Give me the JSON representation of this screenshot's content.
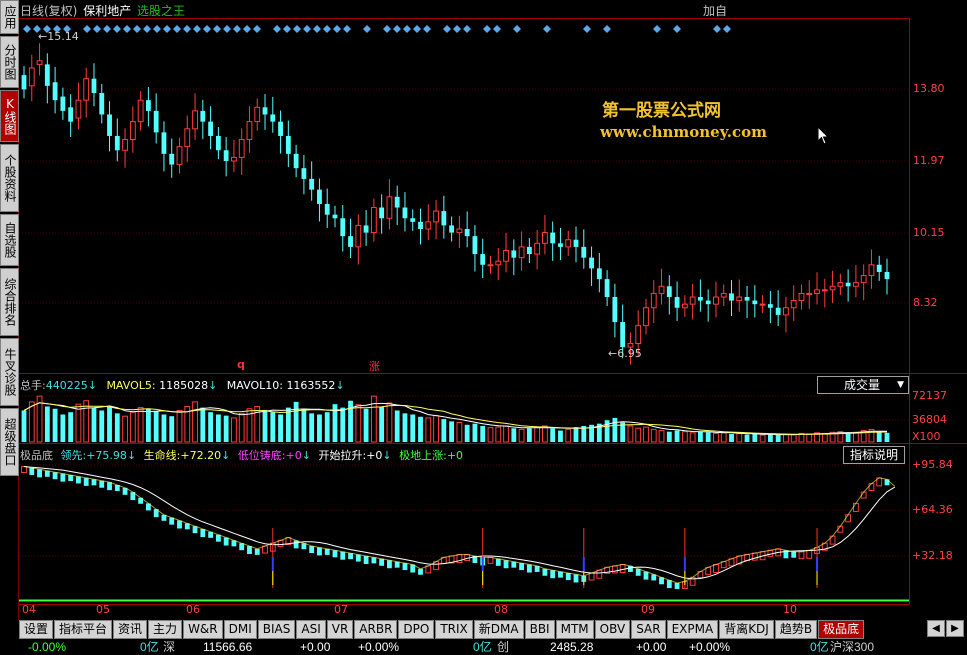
{
  "sidebar": [
    {
      "label": "应用",
      "active": false
    },
    {
      "label": "分时图",
      "active": false
    },
    {
      "label": "K线图",
      "active": true
    },
    {
      "label": "个股资料",
      "active": false
    },
    {
      "label": "自选股",
      "active": false
    },
    {
      "label": "综合排名",
      "active": false
    },
    {
      "label": "牛叉诊股",
      "active": false
    },
    {
      "label": "超级盘口",
      "active": false
    }
  ],
  "header": {
    "period": "日线(复权)",
    "stock_name": "保利地产",
    "formula": "选股之王",
    "right_label": "加自"
  },
  "watermark": {
    "line1": "第一股票公式网",
    "line2": "www.chnmoney.com"
  },
  "price_panel": {
    "high_label": "15.14",
    "low_label": "6.95",
    "axis_labels": [
      "13.80",
      "11.97",
      "10.15",
      "8.32"
    ],
    "marks": [
      {
        "text": "q"
      },
      {
        "text": "涨"
      }
    ]
  },
  "volume_panel": {
    "zongshou_label": "总手:",
    "zongshou_value": "440225",
    "mavol5_label": "MAVOL5:",
    "mavol5_value": "1185028",
    "mavol10_label": "MAVOL10:",
    "mavol10_value": "1163552",
    "selector": "成交量",
    "axis_labels": [
      "72137",
      "36804",
      "X100"
    ]
  },
  "indicator_panel": {
    "name": "极品底",
    "items": [
      {
        "label": "领先:",
        "value": "+75.98",
        "color": "#40e0e0"
      },
      {
        "label": "生命线:",
        "value": "+72.20",
        "color": "#ffff60"
      },
      {
        "label": "低位铸底:",
        "value": "+0",
        "color": "#ff40ff"
      },
      {
        "label": "开始拉升:",
        "value": "+0",
        "color": "#ffffff"
      },
      {
        "label": "极地上涨:",
        "value": "+0",
        "color": "#40ff40"
      }
    ],
    "explain_button": "指标说明",
    "axis_labels": [
      "+95.84",
      "+64.36",
      "+32.18"
    ]
  },
  "x_axis_labels": [
    "04",
    "05",
    "06",
    "07",
    "08",
    "09",
    "10"
  ],
  "tabs": [
    "设置",
    "指标平台",
    "资讯",
    "主力",
    "W&R",
    "DMI",
    "BIAS",
    "ASI",
    "VR",
    "ARBR",
    "DPO",
    "TRIX",
    "新DMA",
    "BBI",
    "MTM",
    "OBV",
    "SAR",
    "EXPMA",
    "背离KDJ",
    "趋势B",
    "极品底"
  ],
  "active_tab": "极品底",
  "status": {
    "idx1_change": "-0.00%",
    "idx1_amount": "0亿",
    "idx2_name": "深",
    "idx2_value": "11566.66",
    "idx2_change": "+0.00",
    "idx2_pct": "+0.00%",
    "idx2_amount": "0亿",
    "idx3_name": "创",
    "idx3_value": "2485.28",
    "idx3_change": "+0.00",
    "idx3_pct": "+0.00%",
    "idx3_amount": "0亿",
    "idx4_name": "沪深300"
  },
  "chart_data": {
    "type": "candlestick",
    "price_range": [
      6.5,
      16.0
    ],
    "indicator_range": [
      0,
      100
    ],
    "close": [
      14.2,
      14.8,
      15.0,
      14.3,
      13.9,
      13.6,
      13.3,
      13.9,
      14.5,
      14.1,
      13.5,
      12.9,
      12.5,
      12.8,
      13.3,
      13.9,
      13.6,
      13.0,
      12.4,
      12.1,
      12.6,
      13.1,
      13.6,
      13.3,
      12.9,
      12.5,
      12.2,
      12.3,
      12.8,
      13.3,
      13.7,
      13.5,
      13.3,
      12.9,
      12.4,
      12.0,
      11.7,
      11.4,
      11.0,
      10.7,
      10.6,
      10.1,
      9.8,
      10.4,
      10.2,
      10.9,
      10.6,
      11.2,
      10.9,
      10.6,
      10.5,
      10.3,
      10.5,
      10.8,
      10.4,
      10.2,
      10.3,
      10.1,
      9.6,
      9.3,
      9.3,
      9.4,
      9.7,
      9.5,
      9.8,
      9.6,
      9.9,
      10.2,
      9.9,
      9.8,
      10.0,
      9.8,
      9.5,
      9.2,
      8.9,
      8.4,
      7.7,
      7.0,
      7.1,
      7.6,
      8.1,
      8.5,
      8.7,
      8.4,
      8.1,
      8.2,
      8.4,
      8.3,
      8.2,
      8.4,
      8.5,
      8.3,
      8.4,
      8.3,
      8.2,
      8.2,
      8.1,
      7.9,
      8.1,
      8.3,
      8.5,
      8.5,
      8.6,
      8.6,
      8.7,
      8.8,
      8.7,
      8.8,
      9.0,
      9.3,
      9.1,
      8.9
    ],
    "open": [
      14.6,
      14.3,
      14.9,
      14.9,
      14.4,
      14.0,
      13.7,
      13.4,
      13.9,
      14.5,
      14.1,
      13.5,
      12.9,
      12.5,
      12.8,
      13.3,
      13.9,
      13.6,
      13.0,
      12.4,
      12.1,
      12.6,
      13.1,
      13.6,
      13.3,
      12.9,
      12.5,
      12.2,
      12.3,
      12.8,
      13.3,
      13.7,
      13.5,
      13.3,
      12.9,
      12.4,
      12.0,
      11.7,
      11.4,
      11.0,
      10.7,
      10.6,
      10.1,
      9.8,
      10.4,
      10.2,
      10.9,
      10.6,
      11.2,
      10.9,
      10.6,
      10.5,
      10.3,
      10.5,
      10.8,
      10.4,
      10.2,
      10.3,
      10.1,
      9.6,
      9.3,
      9.3,
      9.4,
      9.7,
      9.5,
      9.8,
      9.6,
      9.9,
      10.2,
      9.9,
      9.8,
      10.0,
      9.8,
      9.5,
      9.2,
      8.9,
      8.4,
      7.7,
      7.0,
      7.1,
      7.6,
      8.1,
      8.5,
      8.7,
      8.4,
      8.1,
      8.2,
      8.4,
      8.3,
      8.2,
      8.4,
      8.5,
      8.3,
      8.4,
      8.3,
      8.2,
      8.2,
      8.1,
      7.9,
      8.1,
      8.3,
      8.5,
      8.5,
      8.6,
      8.6,
      8.7,
      8.8,
      8.7,
      8.8,
      9.0,
      9.3,
      9.1
    ],
    "volume_index": [
      55,
      70,
      80,
      62,
      58,
      48,
      52,
      66,
      72,
      60,
      55,
      62,
      50,
      45,
      52,
      60,
      58,
      54,
      48,
      45,
      55,
      62,
      70,
      60,
      52,
      48,
      46,
      42,
      50,
      58,
      62,
      56,
      52,
      48,
      60,
      70,
      58,
      50,
      48,
      52,
      66,
      60,
      72,
      65,
      58,
      80,
      62,
      68,
      55,
      50,
      48,
      44,
      42,
      46,
      40,
      36,
      34,
      30,
      32,
      28,
      25,
      26,
      28,
      24,
      22,
      24,
      26,
      28,
      24,
      20,
      22,
      26,
      28,
      30,
      32,
      38,
      42,
      34,
      28,
      24,
      26,
      22,
      20,
      18,
      20,
      18,
      16,
      18,
      17,
      15,
      16,
      14,
      15,
      13,
      14,
      12,
      13,
      12,
      14,
      13,
      15,
      14,
      16,
      15,
      17,
      18,
      16,
      17,
      20,
      22,
      18,
      16
    ],
    "indicator_lead": [
      94,
      93,
      92,
      91,
      90,
      89,
      88,
      87,
      86,
      85,
      84,
      83,
      81,
      79,
      76,
      72,
      68,
      64,
      60,
      58,
      56,
      54,
      52,
      50,
      48,
      46,
      44,
      42,
      40,
      38,
      36,
      38,
      40,
      42,
      44,
      42,
      40,
      38,
      37,
      36,
      35,
      34,
      33,
      32,
      31,
      30,
      29,
      28,
      27,
      26,
      25,
      22,
      24,
      27,
      30,
      31,
      32,
      32,
      31,
      30,
      30,
      29,
      28,
      27,
      26,
      25,
      24,
      22,
      21,
      20,
      19,
      18,
      17,
      19,
      21,
      23,
      24,
      25,
      24,
      22,
      20,
      18,
      16,
      14,
      12,
      13,
      16,
      20,
      23,
      25,
      27,
      29,
      31,
      32,
      33,
      34,
      35,
      36,
      35,
      34,
      34,
      35,
      37,
      40,
      45,
      52,
      60,
      68,
      76,
      82,
      86,
      85,
      80
    ]
  }
}
